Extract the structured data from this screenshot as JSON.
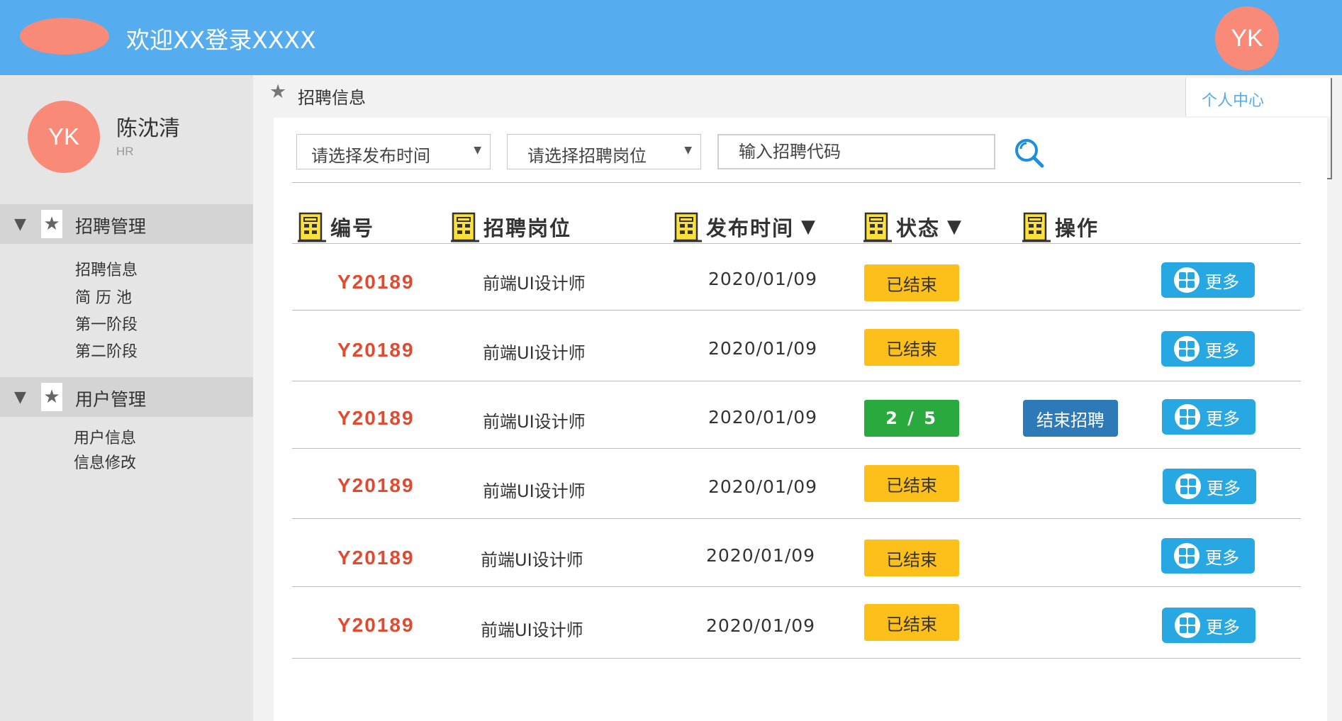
{
  "header": {
    "title": "欢迎XX登录XXXX",
    "avatar_text": "YK"
  },
  "sidebar": {
    "avatar_text": "YK",
    "user_name": "陈沈清",
    "user_role": "HR",
    "groups": [
      {
        "label": "招聘管理",
        "items": [
          "招聘信息",
          "简 历 池",
          "第一阶段",
          "第二阶段"
        ]
      },
      {
        "label": "用户管理",
        "items": [
          "用户信息",
          "信息修改"
        ]
      }
    ]
  },
  "breadcrumb": {
    "label": "招聘信息"
  },
  "tabs": {
    "personal_center": "个人中心"
  },
  "filters": {
    "publish_time_placeholder": "请选择发布时间",
    "position_placeholder": "请选择招聘岗位",
    "code_placeholder": "输入招聘代码"
  },
  "table": {
    "headers": {
      "code": "编号",
      "position": "招聘岗位",
      "publish_time": "发布时间",
      "status": "状态",
      "action": "操作"
    },
    "rows": [
      {
        "code": "Y20189",
        "position": "前端UI设计师",
        "date": "2020/01/09",
        "status": "已结束",
        "status_type": "ended",
        "end_action": "",
        "more": "更多"
      },
      {
        "code": "Y20189",
        "position": "前端UI设计师",
        "date": "2020/01/09",
        "status": "已结束",
        "status_type": "ended",
        "end_action": "",
        "more": "更多"
      },
      {
        "code": "Y20189",
        "position": "前端UI设计师",
        "date": "2020/01/09",
        "status": "2 / 5",
        "status_type": "active",
        "end_action": "结束招聘",
        "more": "更多"
      },
      {
        "code": "Y20189",
        "position": "前端UI设计师",
        "date": "2020/01/09",
        "status": "已结束",
        "status_type": "ended",
        "end_action": "",
        "more": "更多"
      },
      {
        "code": "Y20189",
        "position": "前端UI设计师",
        "date": "2020/01/09",
        "status": "已结束",
        "status_type": "ended",
        "end_action": "",
        "more": "更多"
      },
      {
        "code": "Y20189",
        "position": "前端UI设计师",
        "date": "2020/01/09",
        "status": "已结束",
        "status_type": "ended",
        "end_action": "",
        "more": "更多"
      }
    ]
  },
  "colors": {
    "header_bg": "#55acee",
    "avatar_bg": "#f98a77",
    "code_text": "#e04a30",
    "status_ended": "#fdbf1a",
    "status_active": "#2aaa3e",
    "end_button": "#2e7ab8",
    "more_button": "#27a8e2"
  },
  "icons": {
    "logo": "logo-ellipse",
    "menu_collapse": "triangle-down-icon",
    "menu_star": "star-icon",
    "search": "search-icon",
    "table_header": "building-icon",
    "sort": "triangle-down-icon",
    "more": "grid-icon"
  }
}
